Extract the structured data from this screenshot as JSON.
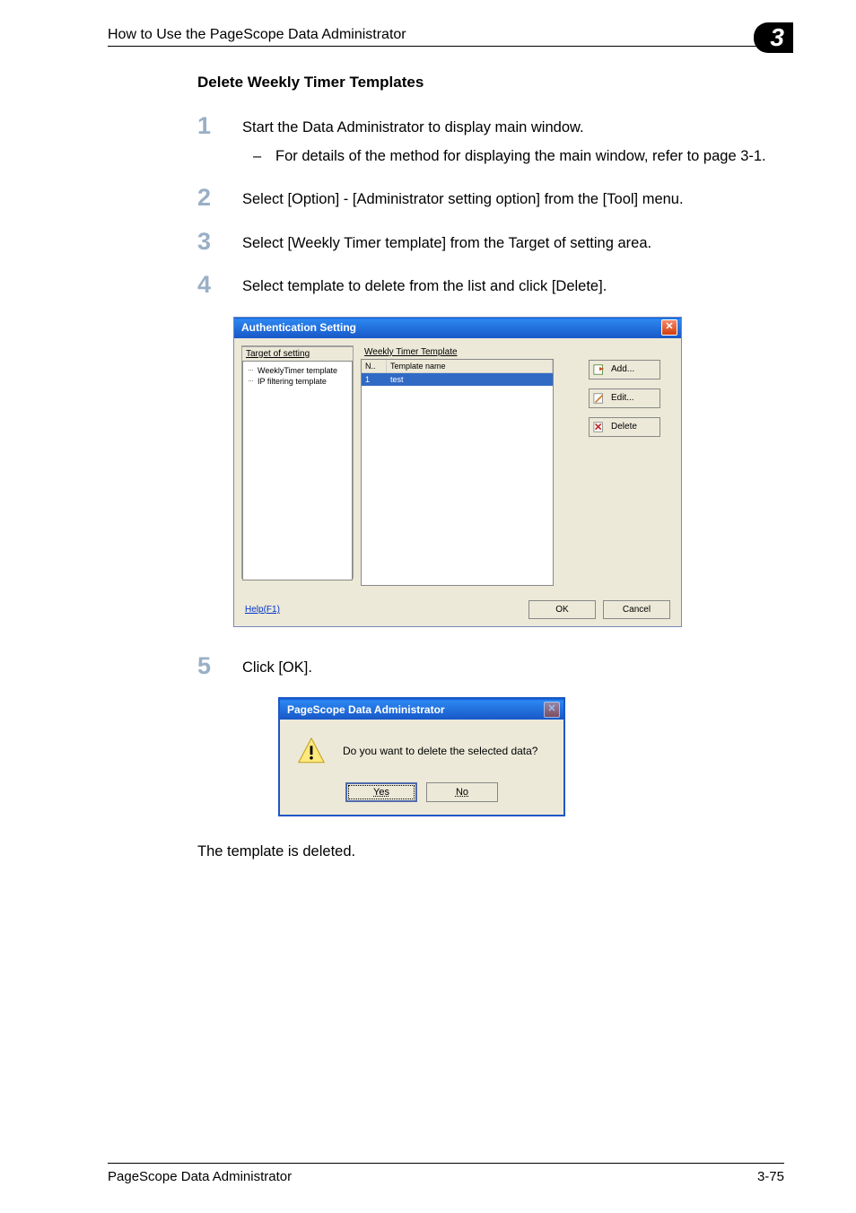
{
  "header": {
    "title": "How to Use the PageScope Data Administrator",
    "chapter_num": "3"
  },
  "subheading": "Delete Weekly Timer Templates",
  "steps": {
    "s1": {
      "num": "1",
      "text": "Start the Data Administrator to display main window.",
      "sub": "For details of the method for displaying the main window, refer to page 3-1."
    },
    "s2": {
      "num": "2",
      "text": "Select [Option] - [Administrator setting option] from the [Tool] menu."
    },
    "s3": {
      "num": "3",
      "text": "Select [Weekly Timer template] from the Target of setting area."
    },
    "s4": {
      "num": "4",
      "text": "Select template to delete from the list and click [Delete]."
    },
    "s5": {
      "num": "5",
      "text": "Click [OK]."
    }
  },
  "dialog1": {
    "title": "Authentication Setting",
    "tree_label": "Target of setting",
    "tree": {
      "item1": "WeeklyTimer template",
      "item2": "IP filtering template"
    },
    "list_label": "Weekly Timer Template",
    "col_num": "N..",
    "col_name": "Template name",
    "row_num": "1",
    "row_name": "test",
    "btn_add": "Add...",
    "btn_edit": "Edit...",
    "btn_delete": "Delete",
    "help": "Help(F1)",
    "ok": "OK",
    "cancel": "Cancel"
  },
  "dialog2": {
    "title": "PageScope Data Administrator",
    "msg": "Do you want to delete the selected data?",
    "yes": "Yes",
    "no": "No"
  },
  "result": "The template is deleted.",
  "footer": {
    "left": "PageScope Data Administrator",
    "right": "3-75"
  }
}
